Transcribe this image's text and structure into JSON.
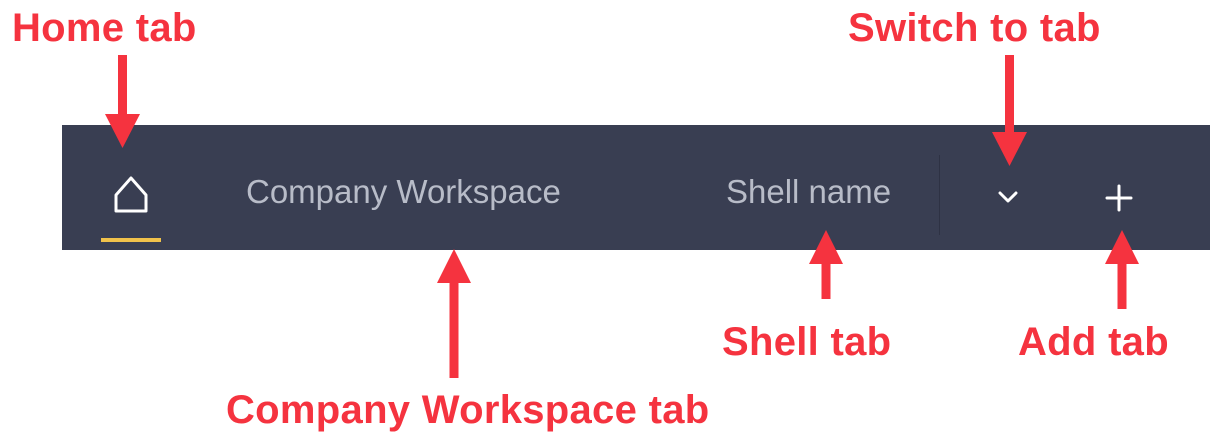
{
  "annotations": {
    "home_tab": "Home tab",
    "switch_to_tab": "Switch to tab",
    "shell_tab": "Shell tab",
    "add_tab": "Add tab",
    "company_workspace_tab": "Company Workspace tab"
  },
  "tabbar": {
    "home_icon": "home-icon",
    "tabs": [
      {
        "label": "Company Workspace"
      },
      {
        "label": "Shell name"
      }
    ],
    "switch_icon": "chevron-down-icon",
    "add_icon": "plus-icon"
  },
  "colors": {
    "tabbar_background": "#393e52",
    "tab_text": "#b8bcc8",
    "active_indicator": "#f0c24b",
    "annotation": "#f5333f"
  }
}
